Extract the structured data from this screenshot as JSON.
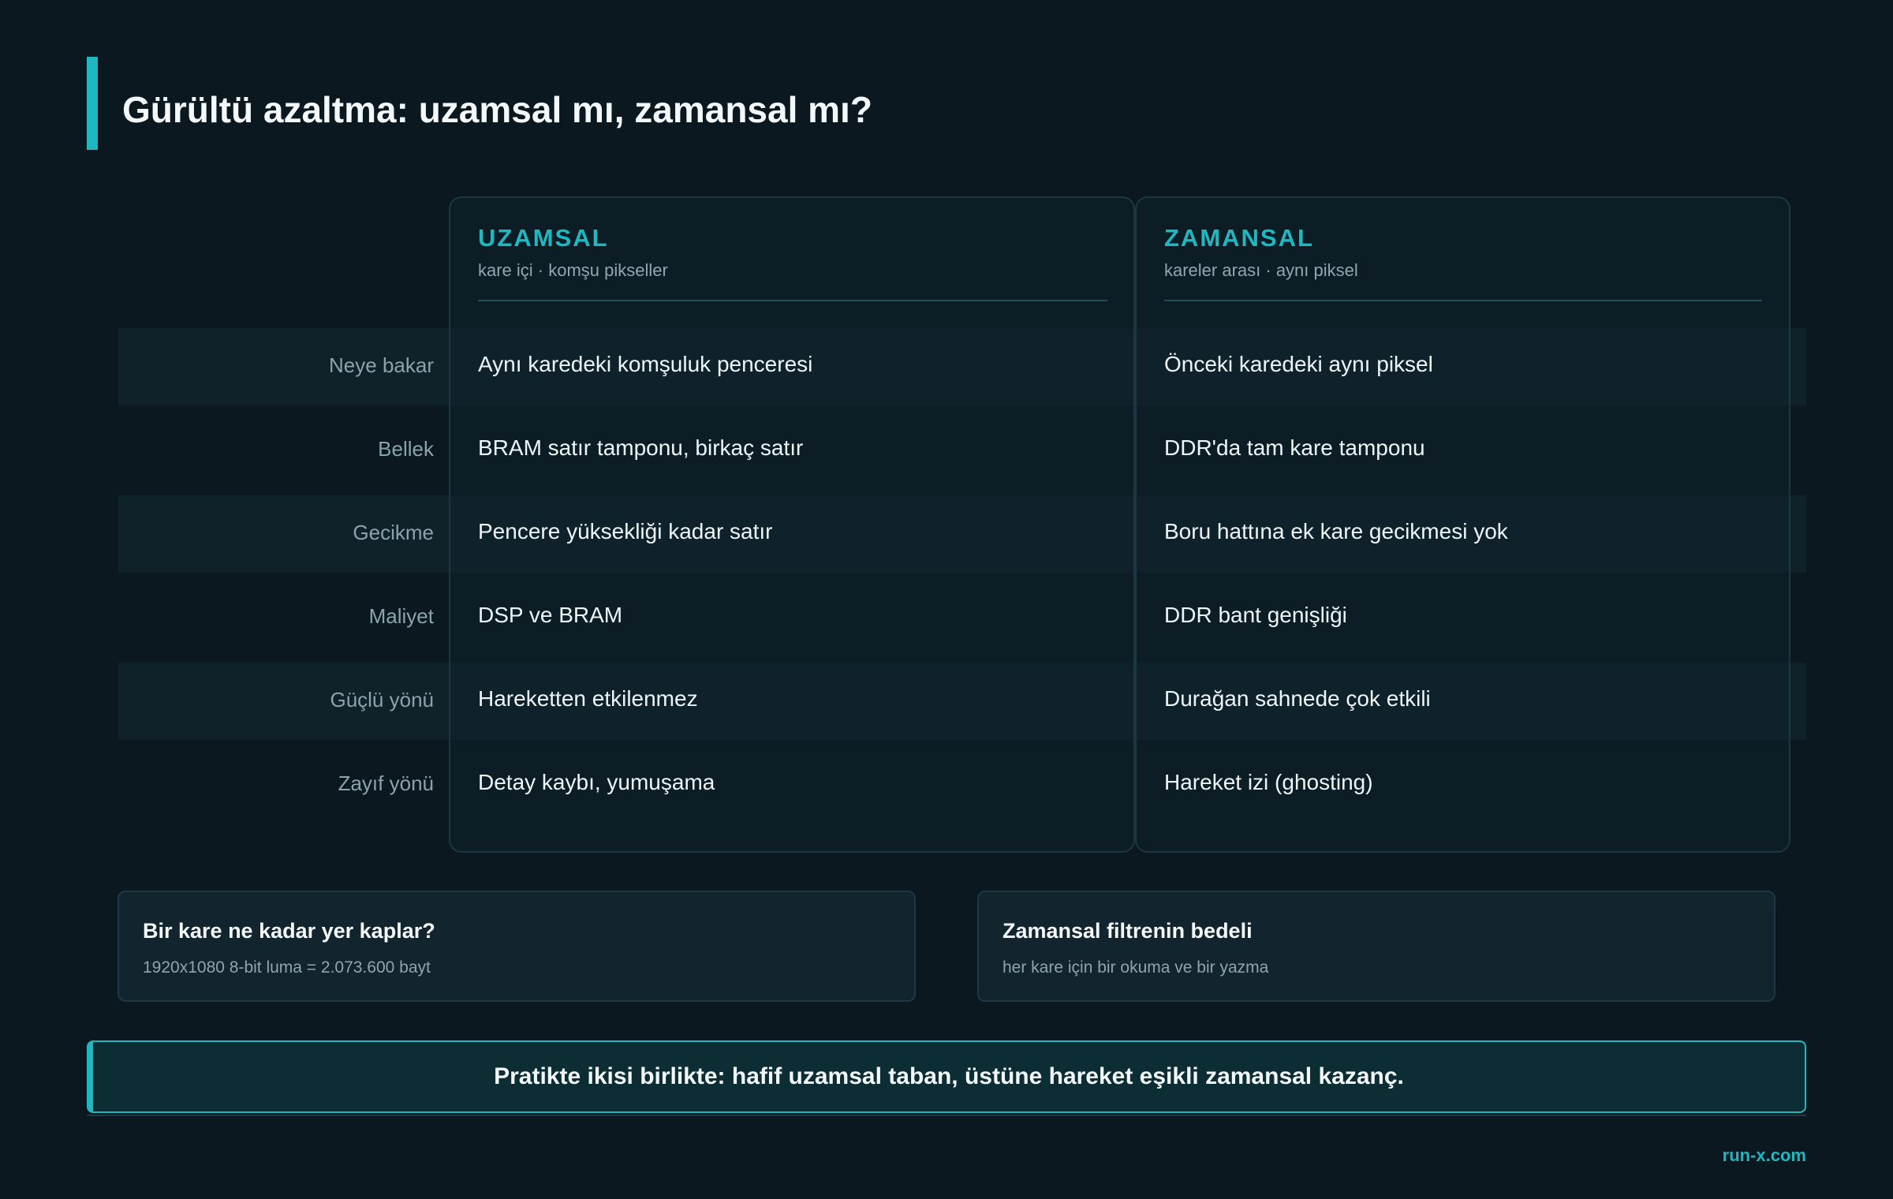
{
  "page": {
    "title": "Gürültü azaltma: uzamsal mı, zamansal mı?"
  },
  "columns": {
    "left": {
      "title": "UZAMSAL",
      "subtitle": "kare içi · komşu pikseller"
    },
    "right": {
      "title": "ZAMANSAL",
      "subtitle": "kareler arası · aynı piksel"
    }
  },
  "rows": [
    {
      "label": "Neye bakar",
      "left": "Aynı karedeki komşuluk penceresi",
      "right": "Önceki karedeki aynı piksel"
    },
    {
      "label": "Bellek",
      "left": "BRAM satır tamponu, birkaç satır",
      "right": "DDR'da tam kare tamponu"
    },
    {
      "label": "Gecikme",
      "left": "Pencere yüksekliği kadar satır",
      "right": "Boru hattına ek kare gecikmesi yok"
    },
    {
      "label": "Maliyet",
      "left": "DSP ve BRAM",
      "right": "DDR bant genişliği"
    },
    {
      "label": "Güçlü yönü",
      "left": "Hareketten etkilenmez",
      "right": "Durağan sahnede çok etkili"
    },
    {
      "label": "Zayıf yönü",
      "left": "Detay kaybı, yumuşama",
      "right": "Hareket izi (ghosting)"
    }
  ],
  "info_cards": [
    {
      "title": "Bir kare ne kadar yer kaplar?",
      "subtitle": "1920x1080 8-bit luma = 2.073.600 bayt"
    },
    {
      "title": "Zamansal filtrenin bedeli",
      "subtitle": "her kare için bir okuma ve bir yazma"
    }
  ],
  "callout": {
    "text": "Pratikte ikisi birlikte: hafif uzamsal taban, üstüne hareket eşikli zamansal kazanç."
  },
  "brand": {
    "text": "run-x.com"
  },
  "colors": {
    "accent": "#1fb8c0",
    "background": "#0b1820",
    "band": "#0f2129"
  }
}
